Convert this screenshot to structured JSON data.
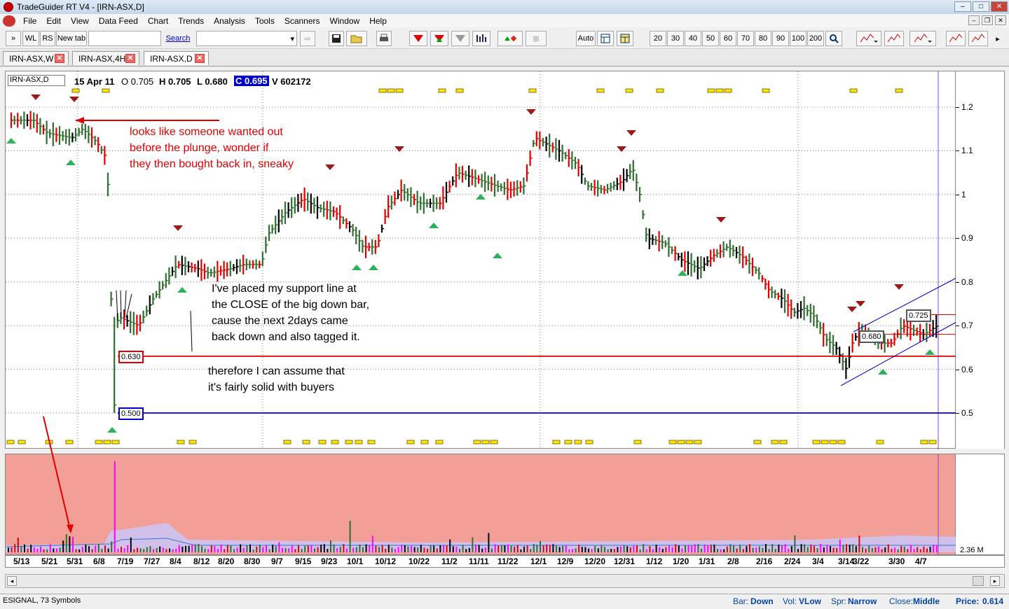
{
  "window": {
    "title": "TradeGuider RT V4 - [IRN-ASX,D]"
  },
  "menu": [
    "File",
    "Edit",
    "View",
    "Data Feed",
    "Chart",
    "Trends",
    "Analysis",
    "Tools",
    "Scanners",
    "Window",
    "Help"
  ],
  "toolbar": {
    "left_buttons": [
      "WL",
      "RS",
      "New tab"
    ],
    "search_link": "Search",
    "auto_label": "Auto",
    "periods": [
      "20",
      "30",
      "40",
      "50",
      "60",
      "70",
      "80",
      "90",
      "100",
      "200"
    ]
  },
  "tabs": [
    {
      "label": "IRN-ASX,W"
    },
    {
      "label": "IRN-ASX,4H"
    },
    {
      "label": "IRN-ASX,D",
      "active": true
    }
  ],
  "chart_info": {
    "symbol": "IRN-ASX,D",
    "date": "15 Apr 11",
    "open": "O 0.705",
    "high": "H 0.705",
    "low": "L 0.680",
    "close": "C 0.695",
    "volume": "V 602172"
  },
  "annotations": {
    "red_note": "looks like someone wanted out\nbefore the plunge, wonder if\nthey then bought back in, sneaky",
    "support_note": "I've placed my support line at\nthe CLOSE of the big down bar,\ncause the next 2days came\nback down and also tagged it.",
    "buyers_note": "therefore I can assume that\nit's fairly solid with buyers"
  },
  "chart_data": {
    "type": "table",
    "price_ticks": [
      "1.2",
      "1.1",
      "1",
      "0.9",
      "0.8",
      "0.7",
      "0.6",
      "0.5"
    ],
    "price_tick_values": [
      1.2,
      1.1,
      1.0,
      0.9,
      0.8,
      0.7,
      0.6,
      0.5
    ],
    "lines": [
      {
        "label": "0.630",
        "price": 0.63,
        "color": "#e00000"
      },
      {
        "label": "0.500",
        "price": 0.5,
        "color": "#0000cc"
      },
      {
        "label": "0.680",
        "price": 0.68,
        "color": "#e00000"
      },
      {
        "label": "0.725",
        "price": 0.725,
        "color": "#e00000"
      }
    ],
    "volume_label": "2.36 M",
    "date_labels": [
      "5/13",
      "5/21",
      "5/31",
      "6/8",
      "7/19",
      "7/27",
      "8/4",
      "8/12",
      "8/20",
      "8/30",
      "9/7",
      "9/15",
      "9/23",
      "10/1",
      "10/12",
      "10/22",
      "11/2",
      "11/11",
      "11/22",
      "12/1",
      "12/9",
      "12/20",
      "12/31",
      "1/12",
      "1/20",
      "1/31",
      "2/8",
      "2/16",
      "2/24",
      "3/4",
      "3/14",
      "3/22",
      "3/30",
      "4/7"
    ]
  },
  "status": {
    "left": "ESIGNAL, 73 Symbols",
    "bar_label": "Bar:",
    "bar_value": "Down",
    "vol_label": "Vol:",
    "vol_value": "VLow",
    "spr_label": "Spr:",
    "spr_value": "Narrow",
    "close_label": "Close:",
    "close_value": "Middle",
    "price_label": "Price:",
    "price_value": "0.614"
  }
}
